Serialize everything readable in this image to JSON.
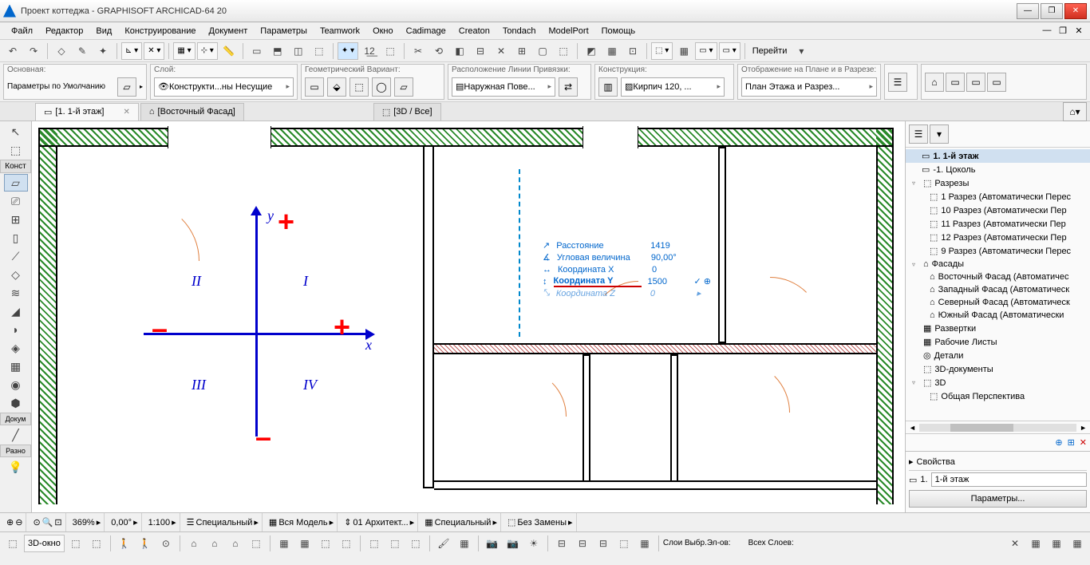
{
  "title": "Проект коттеджа - GRAPHISOFT ARCHICAD-64 20",
  "menu": [
    "Файл",
    "Редактор",
    "Вид",
    "Конструирование",
    "Документ",
    "Параметры",
    "Teamwork",
    "Окно",
    "Cadimage",
    "Creaton",
    "Tondach",
    "ModelPort",
    "Помощь"
  ],
  "goTo": "Перейти",
  "info": {
    "main_lbl": "Основная:",
    "main_val": "Параметры по Умолчанию",
    "layer_lbl": "Слой:",
    "layer_val": "Конструкти...ны Несущие",
    "geom_lbl": "Геометрический Вариант:",
    "snap_lbl": "Расположение Линии Привязки:",
    "snap_val": "Наружная Пове...",
    "struct_lbl": "Конструкция:",
    "struct_val": "Кирпич 120, ...",
    "disp_lbl": "Отображение на Плане и в Разрезе:",
    "disp_val": "План Этажа и Разрез..."
  },
  "tabs": {
    "t1": "[1. 1-й этаж]",
    "t2": "[Восточный Фасад]",
    "t3": "[3D / Все]"
  },
  "toolbox": {
    "arrow": "Конст",
    "doc": "Докум",
    "misc": "Разно"
  },
  "tracker": {
    "dist_lbl": "Расстояние",
    "dist_val": "1419",
    "ang_lbl": "Угловая величина",
    "ang_val": "90,00°",
    "x_lbl": "Координата X",
    "x_val": "0",
    "y_lbl": "Координата Y",
    "y_val": "1500",
    "z_lbl": "Координата Z",
    "z_val": "0"
  },
  "quad": {
    "q1": "I",
    "q2": "II",
    "q3": "III",
    "q4": "IV",
    "x": "x",
    "y": "y"
  },
  "nav": {
    "floor1": "1. 1-й этаж",
    "floor0": "-1. Цоколь",
    "sections": "Разрезы",
    "s1": "1 Разрез (Автоматически Перес",
    "s10": "10 Разрез (Автоматически Пер",
    "s11": "11 Разрез (Автоматически Пер",
    "s12": "12 Разрез (Автоматически Пер",
    "s9": "9 Разрез (Автоматически Перес",
    "elev": "Фасады",
    "e1": "Восточный Фасад (Автоматичес",
    "e2": "Западный Фасад (Автоматическ",
    "e3": "Северный Фасад (Автоматическ",
    "e4": "Южный Фасад (Автоматически",
    "int": "Развертки",
    "ws": "Рабочие Листы",
    "det": "Детали",
    "d3": "3D-документы",
    "d3d": "3D",
    "persp": "Общая Перспектива",
    "props": "Свойства",
    "n1": "1.",
    "nval": "1-й этаж",
    "btn": "Параметры..."
  },
  "status": {
    "zoom": "369%",
    "rot": "0,00°",
    "scale": "1:100",
    "l1": "Специальный",
    "l2": "Вся Модель",
    "l3": "01 Архитект...",
    "l4": "Специальный",
    "l5": "Без Замены"
  },
  "bottom": {
    "b1": "3D-окно",
    "sel": "Слои Выбр.Эл-ов:",
    "all": "Всех Слоев:"
  }
}
